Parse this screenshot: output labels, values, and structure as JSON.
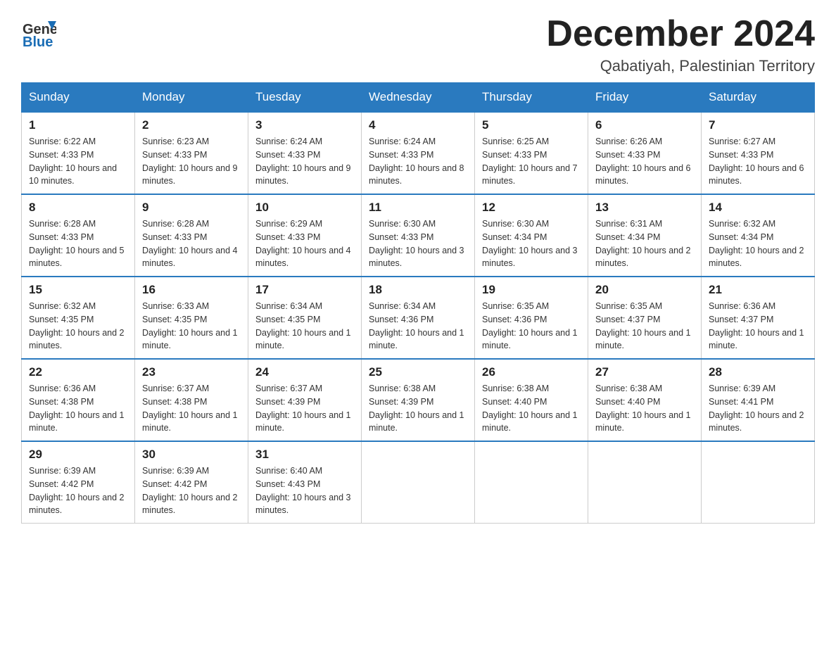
{
  "header": {
    "logo_general": "General",
    "logo_blue": "Blue",
    "month_title": "December 2024",
    "location": "Qabatiyah, Palestinian Territory"
  },
  "days_of_week": [
    "Sunday",
    "Monday",
    "Tuesday",
    "Wednesday",
    "Thursday",
    "Friday",
    "Saturday"
  ],
  "weeks": [
    [
      {
        "date": "1",
        "sunrise": "6:22 AM",
        "sunset": "4:33 PM",
        "daylight": "10 hours and 10 minutes."
      },
      {
        "date": "2",
        "sunrise": "6:23 AM",
        "sunset": "4:33 PM",
        "daylight": "10 hours and 9 minutes."
      },
      {
        "date": "3",
        "sunrise": "6:24 AM",
        "sunset": "4:33 PM",
        "daylight": "10 hours and 9 minutes."
      },
      {
        "date": "4",
        "sunrise": "6:24 AM",
        "sunset": "4:33 PM",
        "daylight": "10 hours and 8 minutes."
      },
      {
        "date": "5",
        "sunrise": "6:25 AM",
        "sunset": "4:33 PM",
        "daylight": "10 hours and 7 minutes."
      },
      {
        "date": "6",
        "sunrise": "6:26 AM",
        "sunset": "4:33 PM",
        "daylight": "10 hours and 6 minutes."
      },
      {
        "date": "7",
        "sunrise": "6:27 AM",
        "sunset": "4:33 PM",
        "daylight": "10 hours and 6 minutes."
      }
    ],
    [
      {
        "date": "8",
        "sunrise": "6:28 AM",
        "sunset": "4:33 PM",
        "daylight": "10 hours and 5 minutes."
      },
      {
        "date": "9",
        "sunrise": "6:28 AM",
        "sunset": "4:33 PM",
        "daylight": "10 hours and 4 minutes."
      },
      {
        "date": "10",
        "sunrise": "6:29 AM",
        "sunset": "4:33 PM",
        "daylight": "10 hours and 4 minutes."
      },
      {
        "date": "11",
        "sunrise": "6:30 AM",
        "sunset": "4:33 PM",
        "daylight": "10 hours and 3 minutes."
      },
      {
        "date": "12",
        "sunrise": "6:30 AM",
        "sunset": "4:34 PM",
        "daylight": "10 hours and 3 minutes."
      },
      {
        "date": "13",
        "sunrise": "6:31 AM",
        "sunset": "4:34 PM",
        "daylight": "10 hours and 2 minutes."
      },
      {
        "date": "14",
        "sunrise": "6:32 AM",
        "sunset": "4:34 PM",
        "daylight": "10 hours and 2 minutes."
      }
    ],
    [
      {
        "date": "15",
        "sunrise": "6:32 AM",
        "sunset": "4:35 PM",
        "daylight": "10 hours and 2 minutes."
      },
      {
        "date": "16",
        "sunrise": "6:33 AM",
        "sunset": "4:35 PM",
        "daylight": "10 hours and 1 minute."
      },
      {
        "date": "17",
        "sunrise": "6:34 AM",
        "sunset": "4:35 PM",
        "daylight": "10 hours and 1 minute."
      },
      {
        "date": "18",
        "sunrise": "6:34 AM",
        "sunset": "4:36 PM",
        "daylight": "10 hours and 1 minute."
      },
      {
        "date": "19",
        "sunrise": "6:35 AM",
        "sunset": "4:36 PM",
        "daylight": "10 hours and 1 minute."
      },
      {
        "date": "20",
        "sunrise": "6:35 AM",
        "sunset": "4:37 PM",
        "daylight": "10 hours and 1 minute."
      },
      {
        "date": "21",
        "sunrise": "6:36 AM",
        "sunset": "4:37 PM",
        "daylight": "10 hours and 1 minute."
      }
    ],
    [
      {
        "date": "22",
        "sunrise": "6:36 AM",
        "sunset": "4:38 PM",
        "daylight": "10 hours and 1 minute."
      },
      {
        "date": "23",
        "sunrise": "6:37 AM",
        "sunset": "4:38 PM",
        "daylight": "10 hours and 1 minute."
      },
      {
        "date": "24",
        "sunrise": "6:37 AM",
        "sunset": "4:39 PM",
        "daylight": "10 hours and 1 minute."
      },
      {
        "date": "25",
        "sunrise": "6:38 AM",
        "sunset": "4:39 PM",
        "daylight": "10 hours and 1 minute."
      },
      {
        "date": "26",
        "sunrise": "6:38 AM",
        "sunset": "4:40 PM",
        "daylight": "10 hours and 1 minute."
      },
      {
        "date": "27",
        "sunrise": "6:38 AM",
        "sunset": "4:40 PM",
        "daylight": "10 hours and 1 minute."
      },
      {
        "date": "28",
        "sunrise": "6:39 AM",
        "sunset": "4:41 PM",
        "daylight": "10 hours and 2 minutes."
      }
    ],
    [
      {
        "date": "29",
        "sunrise": "6:39 AM",
        "sunset": "4:42 PM",
        "daylight": "10 hours and 2 minutes."
      },
      {
        "date": "30",
        "sunrise": "6:39 AM",
        "sunset": "4:42 PM",
        "daylight": "10 hours and 2 minutes."
      },
      {
        "date": "31",
        "sunrise": "6:40 AM",
        "sunset": "4:43 PM",
        "daylight": "10 hours and 3 minutes."
      },
      null,
      null,
      null,
      null
    ]
  ]
}
